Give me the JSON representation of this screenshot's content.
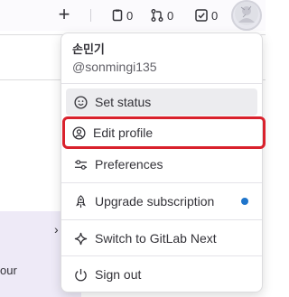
{
  "topbar": {
    "issues_count": "0",
    "merge_requests_count": "0",
    "todos_count": "0"
  },
  "background": {
    "partial_text": "our"
  },
  "user": {
    "name": "손민기",
    "handle": "@sonmingi135"
  },
  "menu": {
    "set_status": "Set status",
    "edit_profile": "Edit profile",
    "preferences": "Preferences",
    "upgrade_subscription": "Upgrade subscription",
    "switch_gitlab_next": "Switch to GitLab Next",
    "sign_out": "Sign out"
  },
  "colors": {
    "highlight_border": "#d9212c",
    "notification_dot": "#1f75cb"
  },
  "icons": [
    "plus-icon",
    "issues-icon",
    "merge-request-icon",
    "todo-icon",
    "avatar",
    "smiley-icon",
    "user-icon",
    "preferences-icon",
    "rocket-icon",
    "sparkle-icon",
    "power-icon"
  ]
}
